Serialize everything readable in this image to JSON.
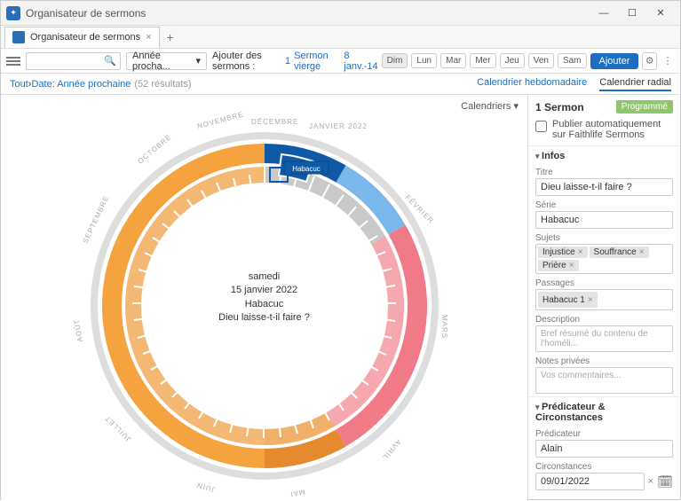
{
  "window": {
    "title": "Organisateur de sermons"
  },
  "tab": {
    "label": "Organisateur de sermons"
  },
  "toolbar": {
    "period": "Année procha...",
    "add_sermons": "Ajouter des sermons :",
    "count": "1",
    "blank_label": "Sermon vierge",
    "date_range": "8 janv.-14",
    "days": [
      "Dim",
      "Lun",
      "Mar",
      "Mer",
      "Jeu",
      "Ven",
      "Sam"
    ],
    "add_button": "Ajouter"
  },
  "filter": {
    "all": "Tout",
    "sep": " › ",
    "date_label": "Date: Année prochaine",
    "results": "(52 résultats)",
    "weekly": "Calendrier hebdomadaire",
    "radial": "Calendrier radial"
  },
  "calendars_label": "Calendriers",
  "chart_data": {
    "type": "radial-calendar",
    "title": "",
    "months": [
      "JANVIER 2022",
      "FÉVRIER",
      "MARS",
      "AVRIL",
      "MAI",
      "JUIN",
      "JUILLET",
      "AOÛT",
      "SEPTEMBRE",
      "OCTOBRE",
      "NOVEMBRE",
      "DÉCEMBRE"
    ],
    "center": {
      "line1": "samedi",
      "line2": "15 janvier 2022",
      "line3": "Habacuc",
      "line4": "Dieu laisse-t-il faire ?"
    },
    "selected_segment": {
      "label": "Habacuc",
      "month": "JANVIER 2022",
      "color": "#0f5aa6"
    },
    "series_arcs": [
      {
        "from_month": 1,
        "to_month": 1,
        "color": "#1b6ec2",
        "label": "Habacuc"
      },
      {
        "from_month": 1,
        "to_month": 2,
        "color": "#7ab8ec"
      },
      {
        "from_month": 2,
        "to_month": 4,
        "color": "#f07a88"
      },
      {
        "from_month": 4,
        "to_month": 5,
        "color": "#e58a2e"
      },
      {
        "from_month": 5,
        "to_month": 12,
        "color": "#f5a33e"
      }
    ]
  },
  "sidepanel": {
    "heading": "1 Sermon",
    "badge": "Programmé",
    "publish": "Publier automatiquement sur Faithlife Sermons",
    "section_info": "Infos",
    "title_label": "Titre",
    "title_value": "Dieu laisse-t-il faire ?",
    "series_label": "Série",
    "series_value": "Habacuc",
    "subjects_label": "Sujets",
    "subjects": [
      "Injustice",
      "Souffrance",
      "Prière"
    ],
    "passages_label": "Passages",
    "passages": [
      "Habacuc 1"
    ],
    "desc_label": "Description",
    "desc_placeholder": "Bref résumé du contenu de l'homéli...",
    "notes_label": "Notes privées",
    "notes_placeholder": "Vos commentaires...",
    "section_preacher": "Prédicateur & Circonstances",
    "preacher_label": "Prédicateur",
    "preacher_value": "Alain",
    "circ_label": "Circonstances",
    "circ_date": "09/01/2022"
  }
}
